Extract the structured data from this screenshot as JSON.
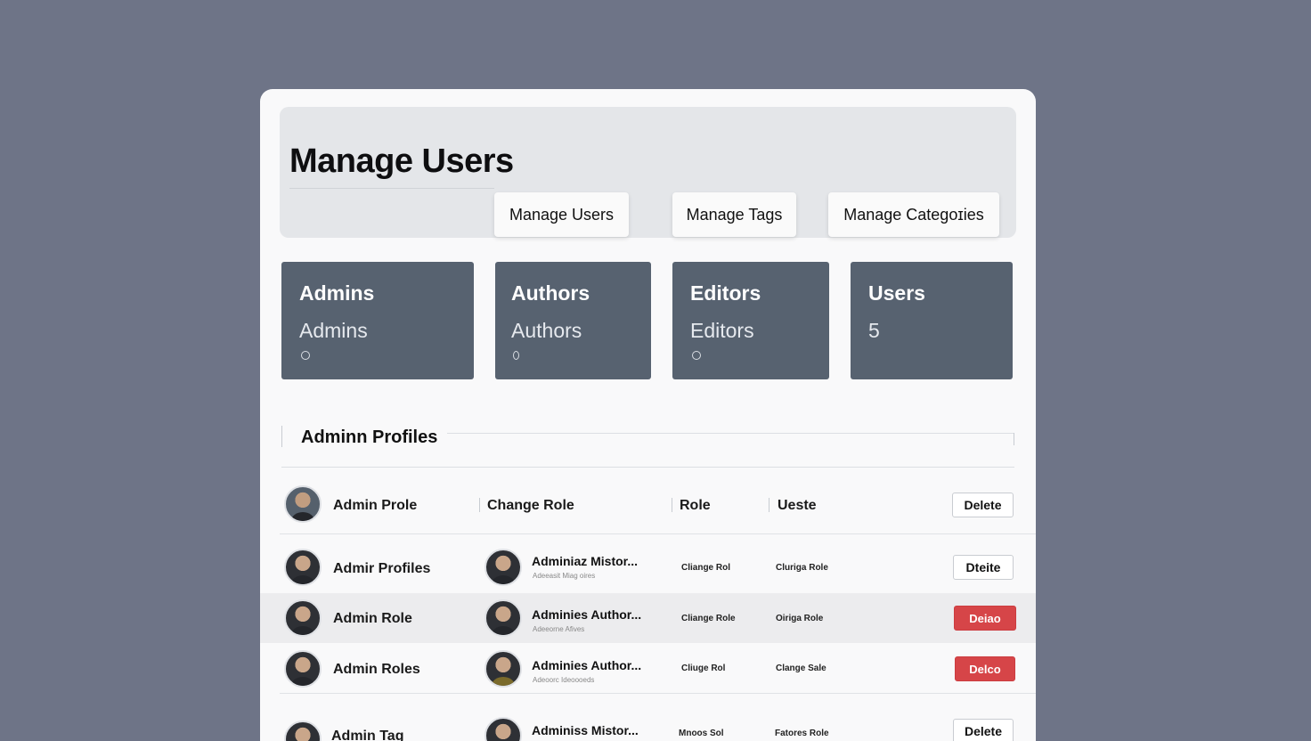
{
  "colors": {
    "background": "#6e7487",
    "card": "#576270",
    "danger": "#d64548"
  },
  "header": {
    "title": "Manage Users",
    "buttons": [
      "Manage Users",
      "Manage Tags",
      "Manage Categoɪies"
    ]
  },
  "cards": [
    {
      "title": "Admins",
      "value": "Admins",
      "icon": "circle-icon"
    },
    {
      "title": "Authors",
      "value": "Authors",
      "icon": "circle-icon"
    },
    {
      "title": "Editors",
      "value": "Editors",
      "icon": "circle-icon"
    },
    {
      "title": "Users",
      "value": "5"
    }
  ],
  "section": {
    "title": "Adminn Profiles"
  },
  "table": {
    "header_row": {
      "name": "Admin Prole",
      "col1": "Change Role",
      "col2": "Role",
      "col3": "Ueste",
      "action": "Delete"
    },
    "rows": [
      {
        "name": "Admir Profiles",
        "sub_name": "Adminiaz Mistor...",
        "sub_text": "Adeeasit   Miag oires",
        "col2": "Cliange Rol",
        "col3": "Cluriga Role",
        "action": "Dteite",
        "action_style": "outline"
      },
      {
        "name": "Admin Role",
        "sub_name": "Adminies Author...",
        "sub_text": "Adeeorne   Afives",
        "col2": "Cliange Role",
        "col3": "Oiriga Role",
        "action": "Deiao",
        "action_style": "danger"
      },
      {
        "name": "Admin Roles",
        "sub_name": "Adminies Author...",
        "sub_text": "Adeoorc   Ideoooeds",
        "col2": "Cliuge Rol",
        "col3": "Clange Sale",
        "action": "Delco",
        "action_style": "danger"
      },
      {
        "name": "Admin Tag",
        "sub_name": "Adminiss Mistor...",
        "sub_text": "",
        "col2": "Mnoos Sol",
        "col3": "Fatores Role",
        "action": "Delete",
        "action_style": "outline"
      }
    ]
  }
}
